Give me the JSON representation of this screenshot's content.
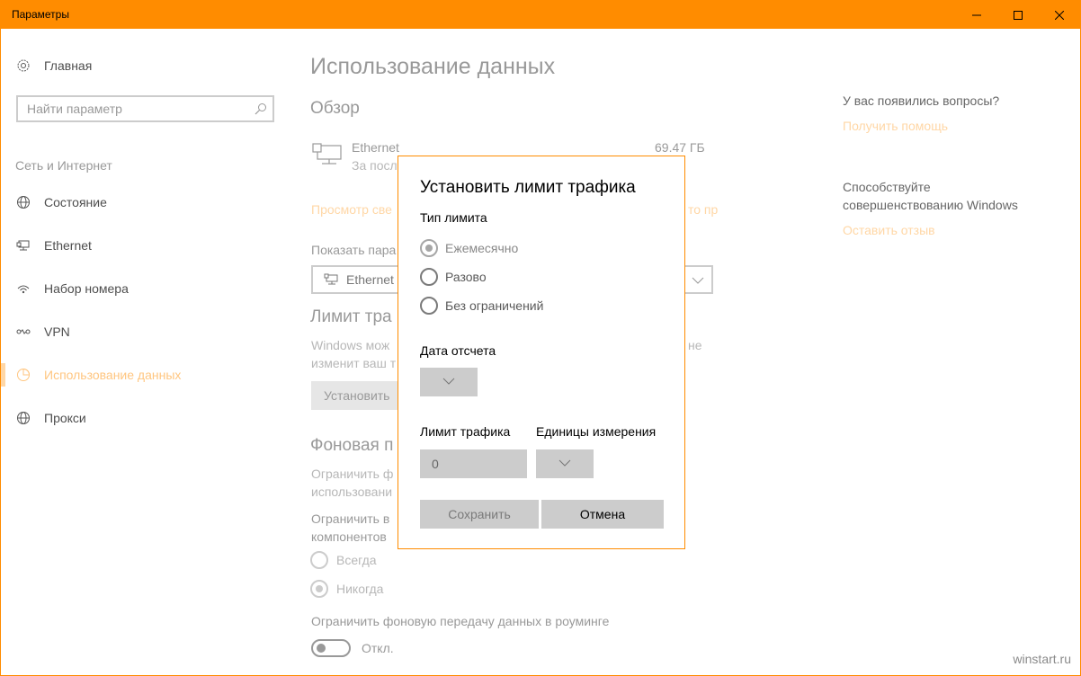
{
  "window": {
    "title": "Параметры",
    "accent": "#ff8c00"
  },
  "sidebar": {
    "home_label": "Главная",
    "search_placeholder": "Найти параметр",
    "section_label": "Сеть и Интернет",
    "items": [
      {
        "label": "Состояние",
        "icon": "globe-icon"
      },
      {
        "label": "Ethernet",
        "icon": "ethernet-icon"
      },
      {
        "label": "Набор номера",
        "icon": "dialup-icon"
      },
      {
        "label": "VPN",
        "icon": "vpn-icon"
      },
      {
        "label": "Использование данных",
        "icon": "data-usage-icon",
        "active": true
      },
      {
        "label": "Прокси",
        "icon": "proxy-globe-icon"
      }
    ]
  },
  "main": {
    "page_title": "Использование данных",
    "overview_heading": "Обзор",
    "overview": {
      "name": "Ethernet",
      "subtitle": "За посл",
      "usage": "69.47 ГБ"
    },
    "view_details_link": "Просмотр све",
    "view_details_link_tail": "то пр",
    "show_params_label": "Показать пара",
    "network_select": "Ethernet",
    "limit_heading": "Лимит тра",
    "limit_desc_line1": "Windows мож",
    "limit_desc_line1_tail": "не",
    "limit_desc_line2": "изменит ваш т",
    "set_limit_button": "Установить",
    "background_heading": "Фоновая п",
    "bg_desc_line1": "Ограничить ф",
    "bg_desc_line2": "использовани",
    "bg_restrict_line1": "Ограничить в",
    "bg_restrict_line2": "компонентов",
    "radio_always": "Всегда",
    "radio_never": "Никогда",
    "roaming_label": "Ограничить фоновую передачу данных в роуминге",
    "toggle_state": "Откл."
  },
  "right": {
    "questions": "У вас появились вопросы?",
    "get_help": "Получить помощь",
    "improve_line1": "Способствуйте",
    "improve_line2": "совершенствованию Windows",
    "feedback": "Оставить отзыв"
  },
  "dialog": {
    "title": "Установить лимит трафика",
    "limit_type_label": "Тип лимита",
    "options": [
      "Ежемесячно",
      "Разово",
      "Без ограничений"
    ],
    "selected_option": "Ежемесячно",
    "reset_date_label": "Дата отсчета",
    "traffic_limit_label": "Лимит трафика",
    "units_label": "Единицы измерения",
    "traffic_limit_value": "0",
    "save_button": "Сохранить",
    "cancel_button": "Отмена"
  },
  "watermark": "winstart.ru"
}
